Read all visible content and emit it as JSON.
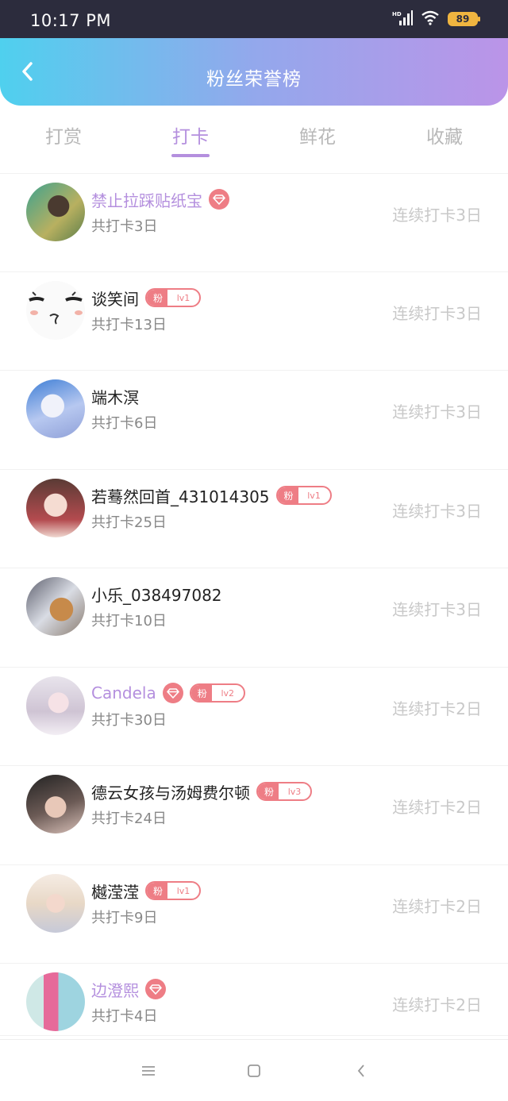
{
  "status_bar": {
    "time": "10:17 PM",
    "battery": "89"
  },
  "header": {
    "title": "粉丝荣誉榜"
  },
  "tabs": [
    {
      "label": "打赏",
      "active": false
    },
    {
      "label": "打卡",
      "active": true
    },
    {
      "label": "鲜花",
      "active": false
    },
    {
      "label": "收藏",
      "active": false
    }
  ],
  "fans": [
    {
      "name": "禁止拉踩贴纸宝",
      "vip": true,
      "fan_badge": "",
      "total": "共打卡3日",
      "streak": "连续打卡3日"
    },
    {
      "name": "谈笑间",
      "vip": false,
      "fan_badge": "lv1",
      "total": "共打卡13日",
      "streak": "连续打卡3日"
    },
    {
      "name": "端木溟",
      "vip": false,
      "fan_badge": "",
      "total": "共打卡6日",
      "streak": "连续打卡3日"
    },
    {
      "name": "若蓦然回首_431014305",
      "vip": false,
      "fan_badge": "lv1",
      "total": "共打卡25日",
      "streak": "连续打卡3日"
    },
    {
      "name": "小乐_038497082",
      "vip": false,
      "fan_badge": "",
      "total": "共打卡10日",
      "streak": "连续打卡3日"
    },
    {
      "name": "Candela",
      "vip": true,
      "fan_badge": "lv2",
      "total": "共打卡30日",
      "streak": "连续打卡2日"
    },
    {
      "name": "德云女孩与汤姆费尔顿",
      "vip": false,
      "fan_badge": "lv3",
      "total": "共打卡24日",
      "streak": "连续打卡2日"
    },
    {
      "name": "樾滢滢",
      "vip": false,
      "fan_badge": "lv1",
      "total": "共打卡9日",
      "streak": "连续打卡2日"
    },
    {
      "name": "边澄熙",
      "vip": true,
      "fan_badge": "",
      "total": "共打卡4日",
      "streak": "连续打卡2日"
    }
  ],
  "fan_badge_char": "粉",
  "colors": {
    "accent": "#b48fde",
    "badge": "#ee7d85",
    "header_start": "#4fd0ee",
    "header_end": "#bb94e8"
  }
}
